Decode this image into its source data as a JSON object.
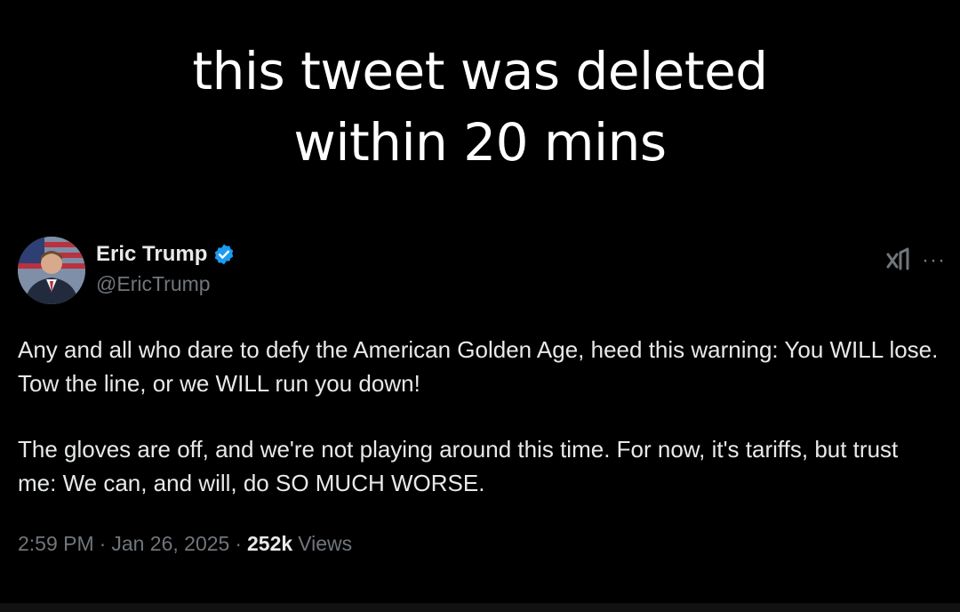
{
  "caption": {
    "line1": "this tweet was deleted",
    "line2": "within 20 mins"
  },
  "tweet": {
    "author": {
      "display_name": "Eric Trump",
      "handle": "@EricTrump",
      "verified": true,
      "avatar_icon": "avatar-photo"
    },
    "icons": {
      "grok": "grok-icon",
      "more": "more-options-icon"
    },
    "more_label": "···",
    "paragraphs": [
      "Any and all who dare to defy the American Golden Age, heed this warning: You WILL lose. Tow the line, or we WILL run you down!",
      "The gloves are off, and we're not playing around this time. For now, it's tariffs, but trust me: We can, and will, do SO MUCH WORSE."
    ],
    "time": "2:59 PM",
    "separator": "·",
    "date": "Jan 26, 2025",
    "views_count": "252k",
    "views_label": "Views"
  },
  "colors": {
    "background": "#000000",
    "primary_text": "#e7e9ea",
    "secondary_text": "#71767b",
    "verified_badge": "#1d9bf0"
  }
}
